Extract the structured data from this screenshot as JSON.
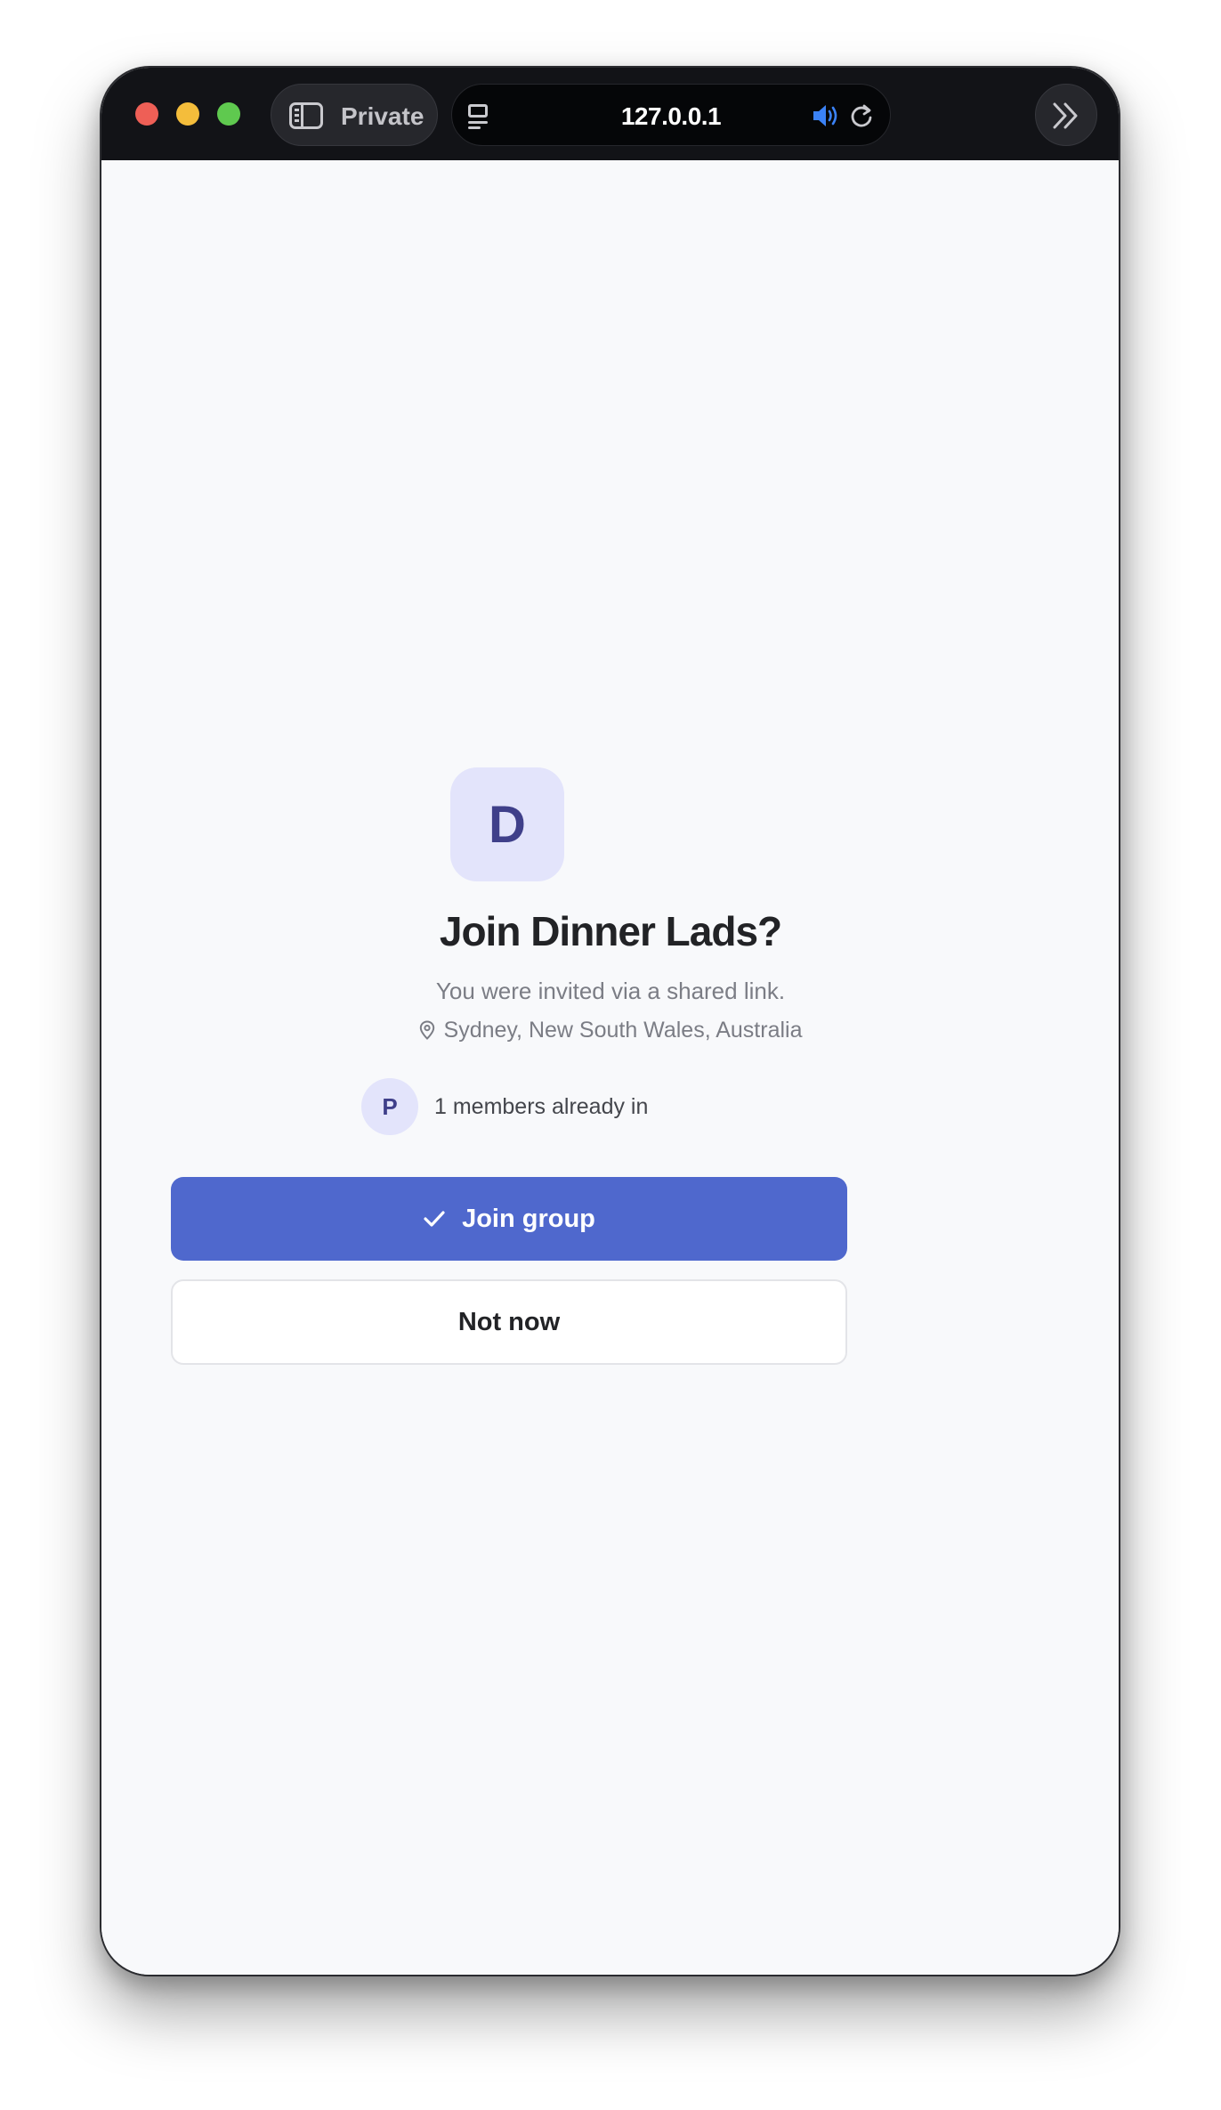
{
  "browser": {
    "private_label": "Private",
    "url": "127.0.0.1"
  },
  "invite": {
    "group_initial": "D",
    "title": "Join Dinner Lads?",
    "subtitle": "You were invited via a shared link.",
    "location": "Sydney, New South Wales, Australia",
    "member_initial": "P",
    "members_text": "1 members already in",
    "join_label": "Join group",
    "not_now_label": "Not now"
  },
  "colors": {
    "primary": "#4f68cd",
    "avatar_bg": "#e3e4fb",
    "avatar_text": "#3f3f8a",
    "speaker_active": "#3b82f6"
  },
  "icons": {
    "window_controls": [
      "close-icon",
      "minimize-icon",
      "zoom-icon"
    ],
    "sidebar": "sidebar-icon",
    "page": "page-icon",
    "audio": "speaker-icon",
    "reload": "reload-icon",
    "overflow": "chevrons-right-icon",
    "location": "map-pin-icon",
    "join": "checkmark-icon"
  }
}
